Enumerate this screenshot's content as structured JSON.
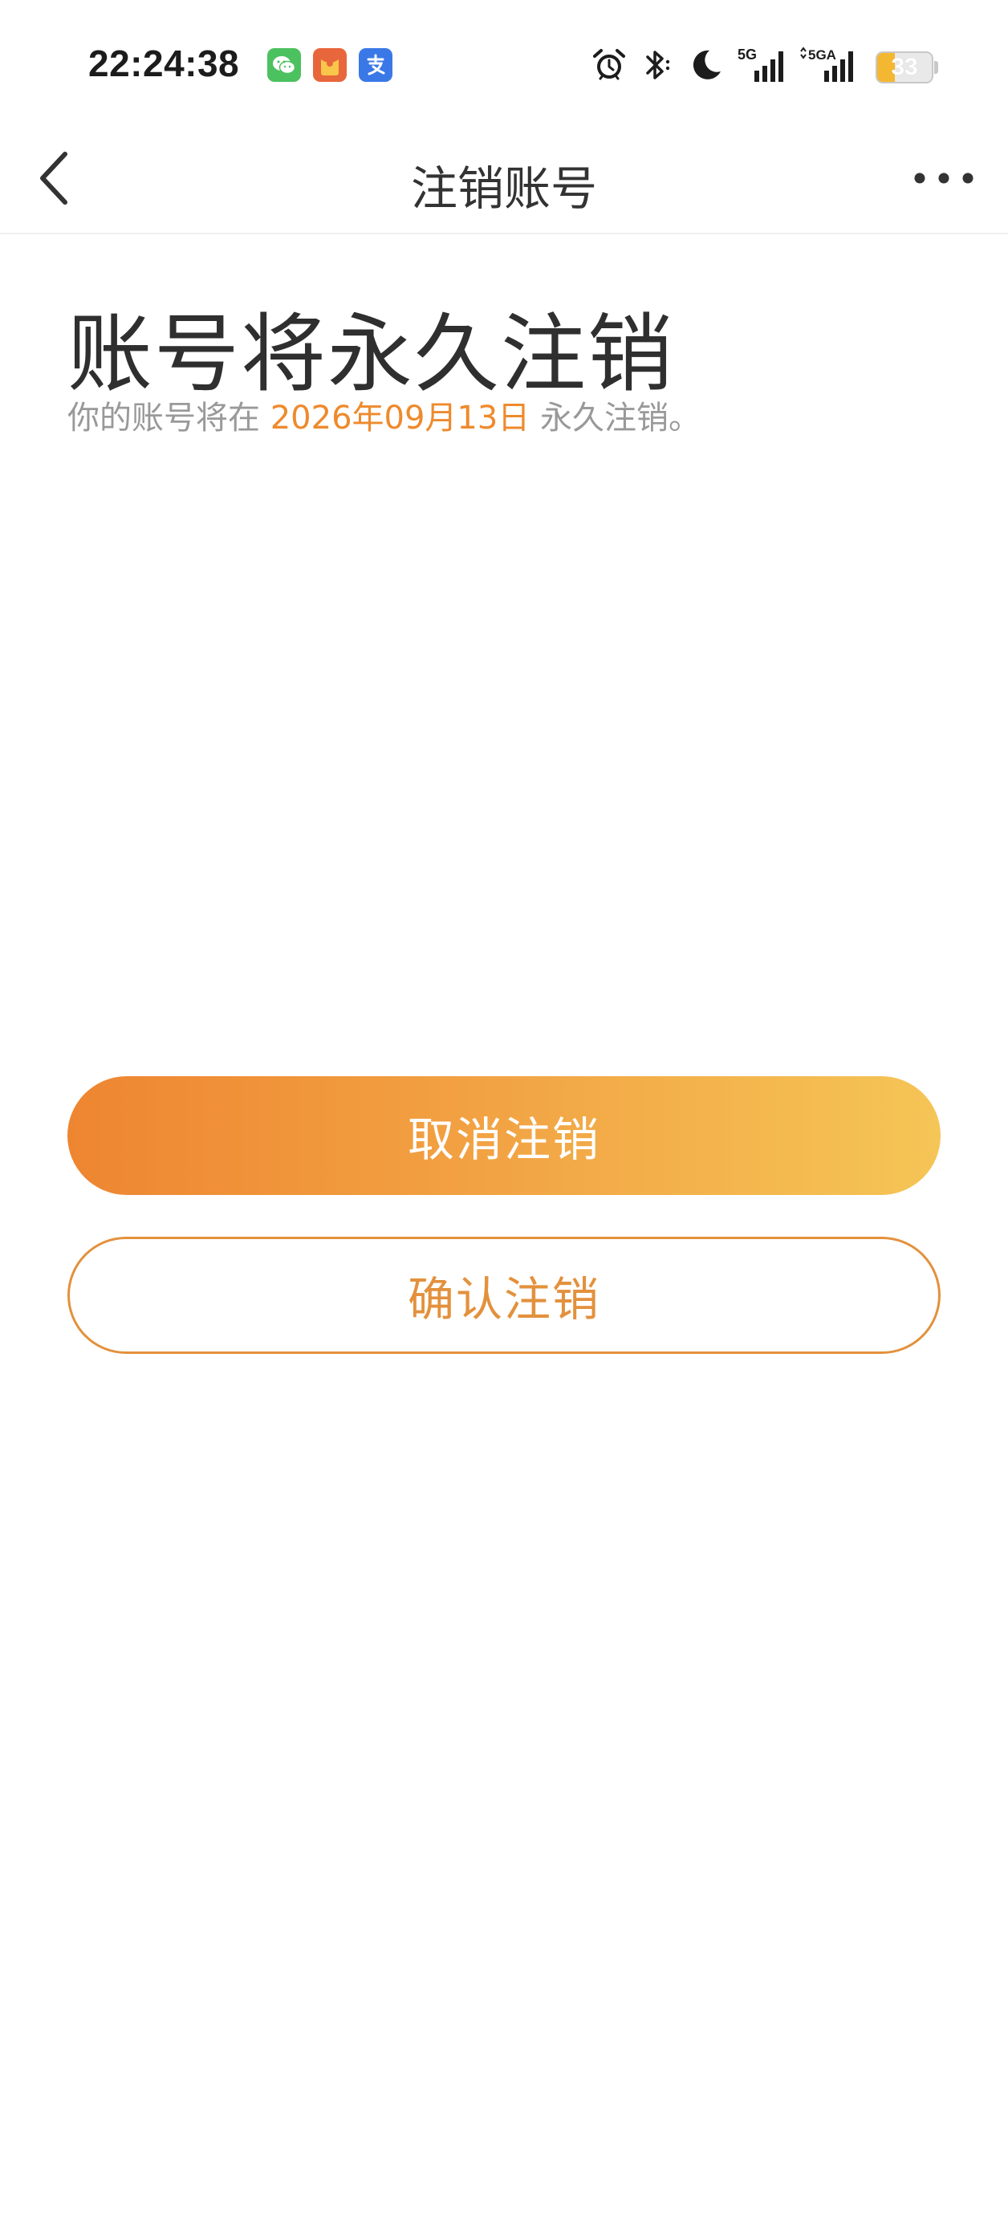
{
  "status_bar": {
    "time": "22:24:38",
    "network_1": "5G",
    "network_2": "5GA",
    "battery_level": "33",
    "battery_fraction": 0.33,
    "icons": [
      "wechat-icon",
      "red-packet-icon",
      "alipay-icon",
      "alarm-icon",
      "bluetooth-icon",
      "moon-icon",
      "signal-5g-icon",
      "signal-5ga-icon",
      "battery-icon"
    ]
  },
  "nav": {
    "title": "注销账号"
  },
  "content": {
    "heading": "账号将永久注销",
    "notice_prefix": "你的账号将在 ",
    "notice_date": "2026年09月13日",
    "notice_suffix": " 永久注销。"
  },
  "actions": {
    "cancel_label": "取消注销",
    "confirm_label": "确认注销"
  },
  "colors": {
    "accent_orange": "#ee8a2d",
    "gradient_start": "#ee8531",
    "gradient_end": "#f5c556",
    "outline": "#e3913d"
  }
}
